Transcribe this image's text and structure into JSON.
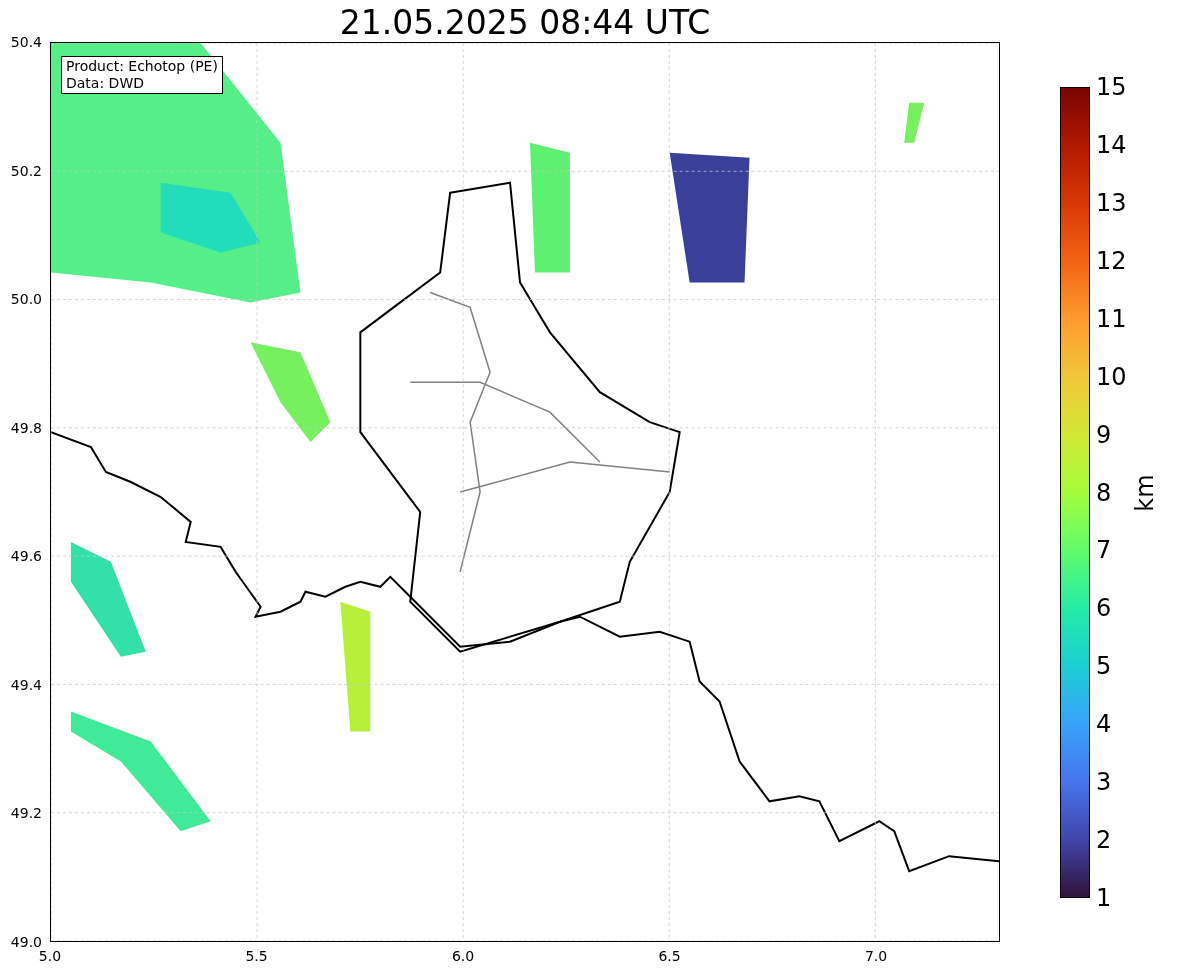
{
  "title": "21.05.2025 08:44 UTC",
  "legend": [
    "Product: Echotop (PE)",
    "Data: DWD"
  ],
  "map": {
    "xticks": [
      "5.0",
      "5.5",
      "6.0",
      "6.5",
      "7.0"
    ],
    "yticks": [
      "50.4",
      "50.2",
      "50.0",
      "49.8",
      "49.6",
      "49.4",
      "49.2",
      "49.0"
    ]
  },
  "colorbar": {
    "label": "km",
    "ticks": [
      "15",
      "14",
      "13",
      "12",
      "11",
      "10",
      "9",
      "8",
      "7",
      "6",
      "5",
      "4",
      "3",
      "2",
      "1"
    ]
  }
}
